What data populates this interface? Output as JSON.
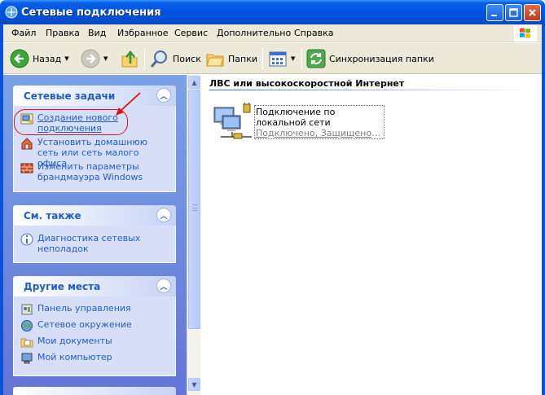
{
  "window": {
    "title": "Сетевые подключения"
  },
  "menu": {
    "items": [
      "Файл",
      "Правка",
      "Вид",
      "Избранное",
      "Сервис",
      "Дополнительно",
      "Справка"
    ]
  },
  "toolbar": {
    "back_label": "Назад",
    "search_label": "Поиск",
    "folders_label": "Папки",
    "sync_label": "Синхронизация папки"
  },
  "taskpane": {
    "network_tasks": {
      "title": "Сетевые задачи",
      "items": [
        {
          "label": "Создание нового подключения",
          "icon": "new-connection-icon"
        },
        {
          "label": "Установить домашнюю сеть или сеть малого офиса",
          "icon": "home-network-icon"
        },
        {
          "label": "Изменить параметры брандмауэра Windows",
          "icon": "firewall-icon"
        }
      ]
    },
    "see_also": {
      "title": "См. также",
      "items": [
        {
          "label": "Диагностика сетевых неполадок",
          "icon": "info-icon"
        }
      ]
    },
    "other_places": {
      "title": "Другие места",
      "items": [
        {
          "label": "Панель управления",
          "icon": "control-panel-icon"
        },
        {
          "label": "Сетевое окружение",
          "icon": "network-places-icon"
        },
        {
          "label": "Мои документы",
          "icon": "my-documents-icon"
        },
        {
          "label": "Мой компьютер",
          "icon": "my-computer-icon"
        }
      ]
    }
  },
  "content": {
    "group_header": "ЛВС или высокоскоростной Интернет",
    "connections": [
      {
        "name": "Подключение по локальной сети",
        "status": "Подключено, Защищено бр..."
      }
    ]
  },
  "colors": {
    "title_bar": "#0054e3",
    "link_blue": "#215dc6",
    "annotation_red": "#e01010"
  }
}
